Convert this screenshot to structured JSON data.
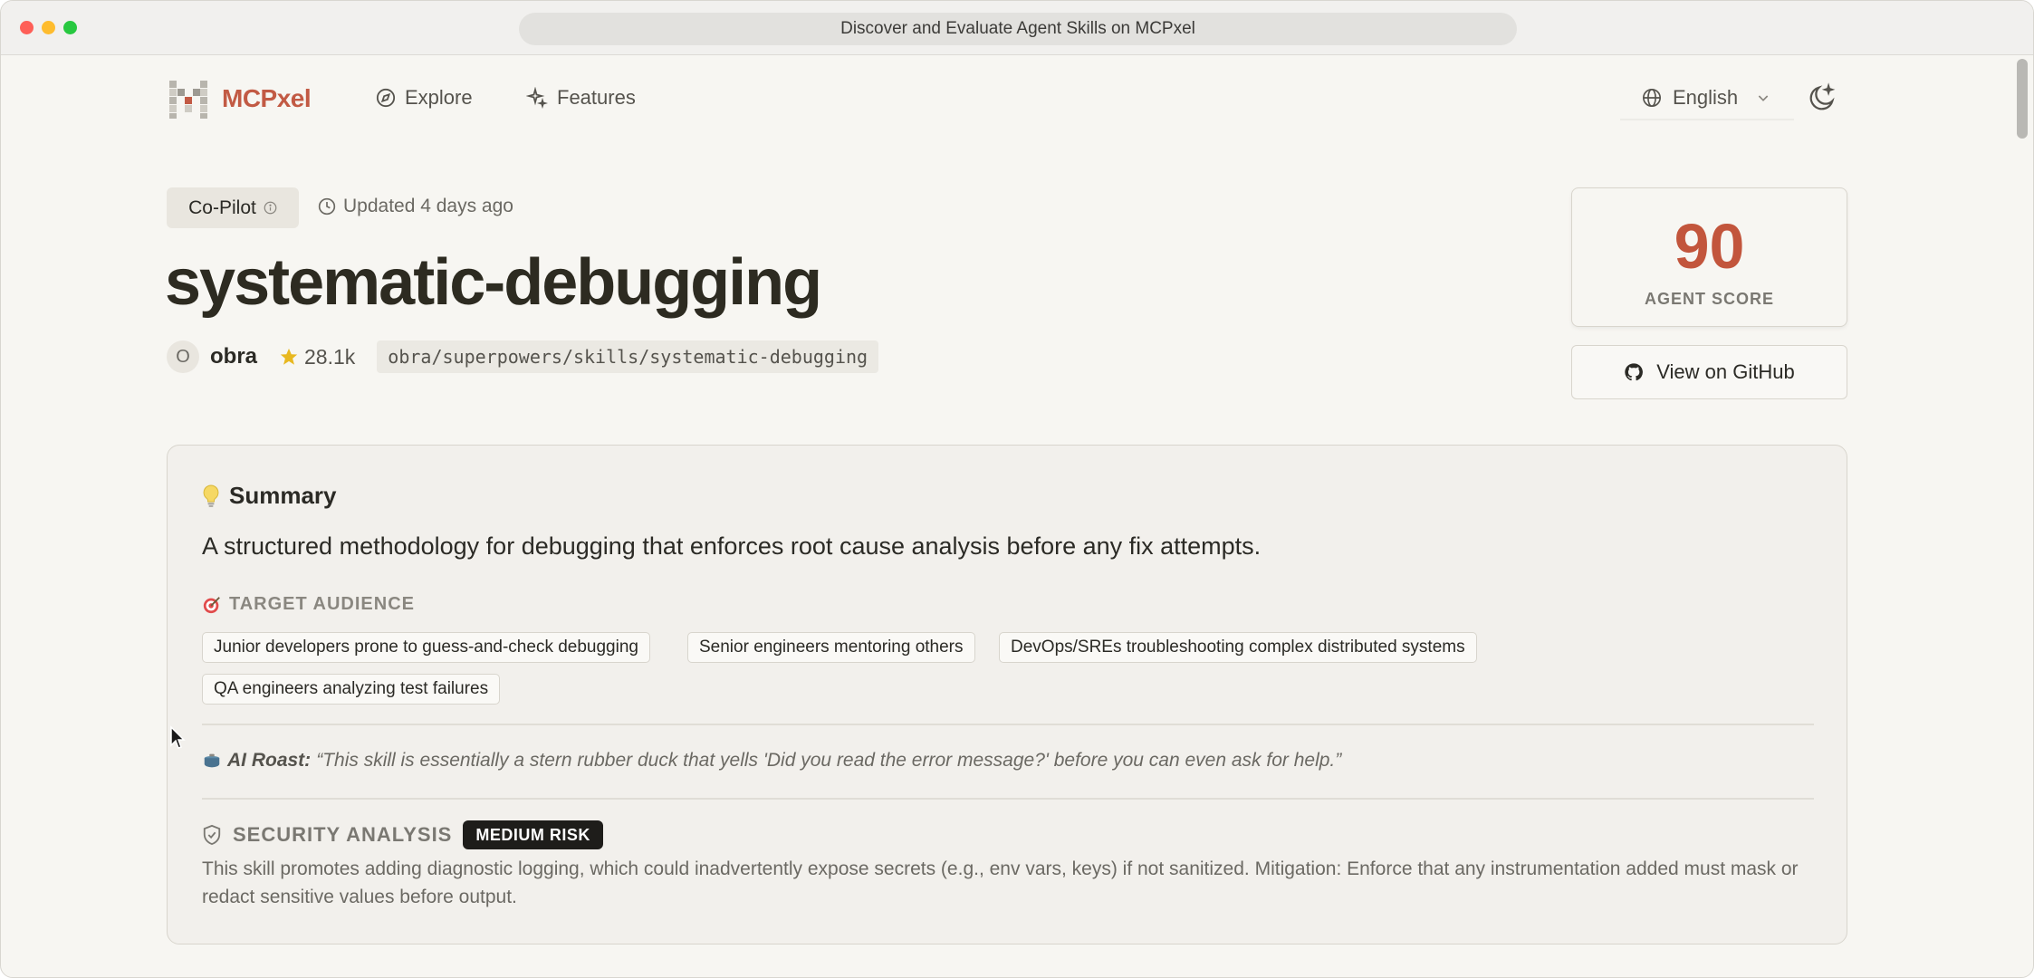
{
  "browser": {
    "url_title": "Discover and Evaluate Agent Skills on MCPxel"
  },
  "nav": {
    "brand": "MCPxel",
    "explore": "Explore",
    "features": "Features",
    "language": "English",
    "icons": {
      "explore": "compass-icon",
      "features": "sparkles-icon",
      "language": "globe-icon",
      "language_dropdown": "chevron-down-icon",
      "theme": "moon-sparkle-icon"
    }
  },
  "skill": {
    "badge": "Co-Pilot",
    "updated": "Updated 4 days ago",
    "title": "systematic-debugging",
    "owner_initial": "O",
    "owner": "obra",
    "stars": "28.1k",
    "path": "obra/superpowers/skills/systematic-debugging"
  },
  "score": {
    "value": "90",
    "label": "AGENT SCORE"
  },
  "github_button": "View on GitHub",
  "summary": {
    "heading": "Summary",
    "text": "A structured methodology for debugging that enforces root cause analysis before any fix attempts.",
    "audience_heading": "TARGET AUDIENCE",
    "audience": [
      "Junior developers prone to guess-and-check debugging",
      "Senior engineers mentoring others",
      "DevOps/SREs troubleshooting complex distributed systems",
      "QA engineers analyzing test failures"
    ],
    "roast_label": "AI Roast:",
    "roast_text": "“This skill is essentially a stern rubber duck that yells 'Did you read the error message?' before you can even ask for help.”",
    "security_heading": "SECURITY ANALYSIS",
    "risk_badge": "MEDIUM RISK",
    "security_text": "This skill promotes adding diagnostic logging, which could inadvertently expose secrets (e.g., env vars, keys) if not sanitized. Mitigation: Enforce that any instrumentation added must mask or redact sensitive values before output."
  },
  "colors": {
    "brand": "#c25a44",
    "score": "#c2553c",
    "star": "#e8b820",
    "risk_badge": "#1e1d1a"
  }
}
